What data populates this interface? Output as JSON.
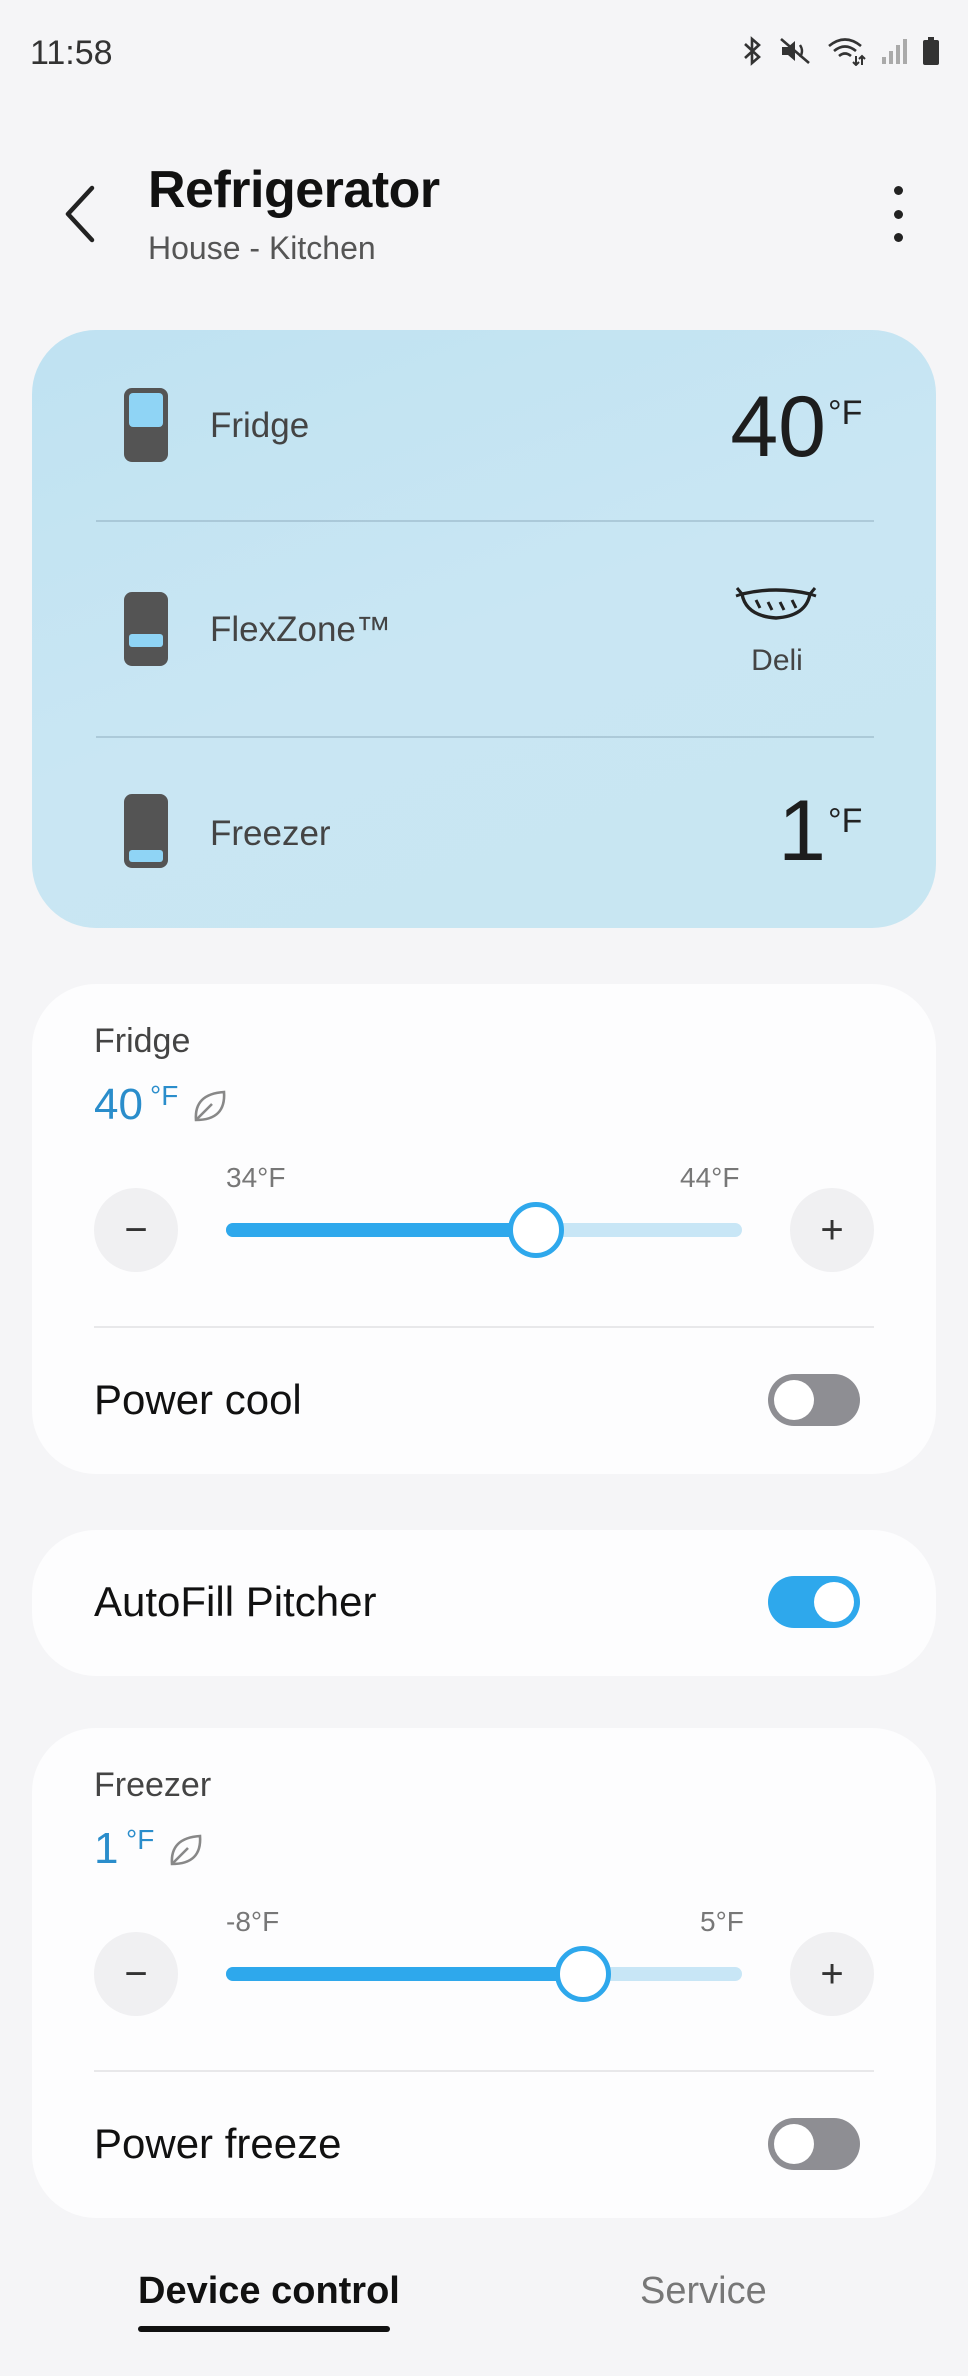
{
  "status_bar": {
    "time": "11:58",
    "icons": [
      "bluetooth-icon",
      "mute-icon",
      "wifi-icon",
      "signal-icon",
      "battery-icon"
    ]
  },
  "header": {
    "title": "Refrigerator",
    "subtitle": "House - Kitchen",
    "back_icon": "chevron-left-icon",
    "more_icon": "more-vertical-icon"
  },
  "overview": {
    "fridge": {
      "label": "Fridge",
      "temp": "40",
      "unit": "°F"
    },
    "flexzone": {
      "label": "FlexZone™",
      "mode_label": "Deli",
      "mode_icon": "deli-icon"
    },
    "freezer": {
      "label": "Freezer",
      "temp": "1",
      "unit": "°F"
    }
  },
  "fridge_card": {
    "label": "Fridge",
    "temp": "40",
    "unit": "°F",
    "eco_icon": "leaf-icon",
    "min_label": "34°F",
    "max_label": "44°F",
    "slider_fraction": 0.6,
    "decrease_label": "−",
    "increase_label": "+",
    "power_cool_label": "Power cool",
    "power_cool_on": false
  },
  "pitcher_card": {
    "label": "AutoFill Pitcher",
    "on": true
  },
  "freezer_card": {
    "label": "Freezer",
    "temp": "1",
    "unit": "°F",
    "eco_icon": "leaf-icon",
    "min_label": "-8°F",
    "max_label": "5°F",
    "slider_fraction": 0.692,
    "decrease_label": "−",
    "increase_label": "+",
    "power_freeze_label": "Power freeze",
    "power_freeze_on": false
  },
  "tabs": [
    {
      "label": "Device control",
      "active": true
    },
    {
      "label": "Service",
      "active": false
    }
  ],
  "colors": {
    "accent": "#2ea8ec",
    "temp_text": "#2a8dcb",
    "overview_bg": "#c4e4f3",
    "toggle_off": "#8e8e93"
  }
}
